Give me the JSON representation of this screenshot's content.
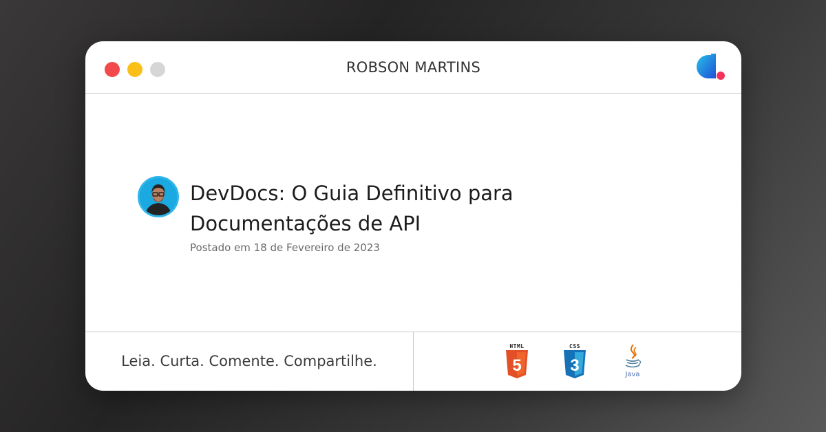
{
  "window": {
    "author": "ROBSON MARTINS",
    "controls": [
      "close",
      "minimize",
      "maximize"
    ],
    "colors": {
      "close": "#f24a4a",
      "minimize": "#fbbf1a",
      "maximize": "#d6d6d6"
    },
    "logo_icon": "devdocs-brand-icon"
  },
  "post": {
    "title": "DevDocs: O Guia Definitivo para Documentações de API",
    "date": "Postado em 18 de Fevereiro de 2023",
    "avatar_icon": "author-avatar"
  },
  "footer": {
    "tagline": "Leia. Curta. Comente. Compartilhe.",
    "technologies": [
      {
        "name": "HTML",
        "icon": "html5-icon",
        "color": "#e34f26"
      },
      {
        "name": "CSS",
        "icon": "css3-icon",
        "color": "#1572b6"
      },
      {
        "name": "Java",
        "icon": "java-icon",
        "color": "#e76f00"
      }
    ]
  }
}
